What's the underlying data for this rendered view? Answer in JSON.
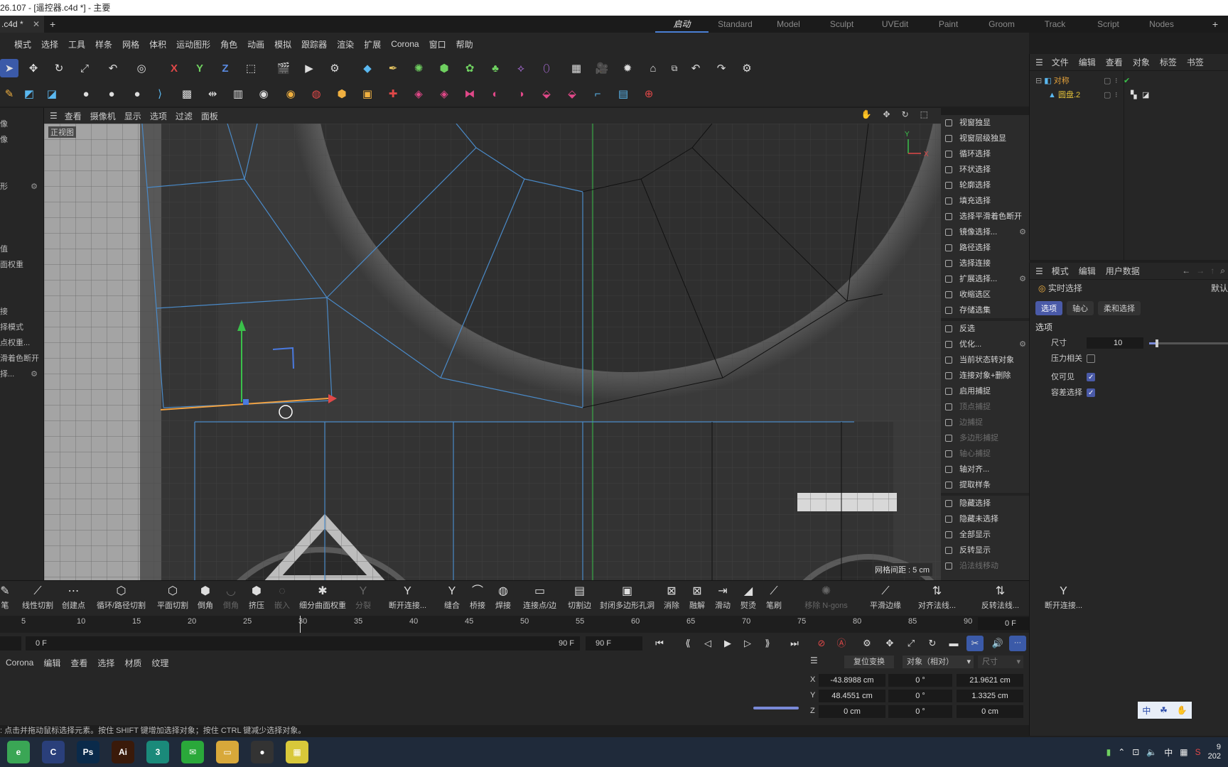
{
  "title": "26.107 - [遥控器.c4d *] - 主要",
  "file_tab": ".c4d *",
  "layouts": [
    "启动",
    "Standard",
    "Model",
    "Sculpt",
    "UVEdit",
    "Paint",
    "Groom",
    "Track",
    "Script",
    "Nodes"
  ],
  "menu": [
    "模式",
    "选择",
    "工具",
    "样条",
    "网格",
    "体积",
    "运动图形",
    "角色",
    "动画",
    "模拟",
    "跟踪器",
    "渲染",
    "扩展",
    "Corona",
    "窗口",
    "帮助"
  ],
  "left_panel": [
    "像",
    "像",
    "",
    "",
    "形",
    "",
    "",
    "",
    "值",
    "面权重",
    "",
    "",
    "接",
    "择模式",
    "点权重...",
    "滑着色断开",
    "择..."
  ],
  "viewport_menu": [
    "查看",
    "摄像机",
    "显示",
    "选项",
    "过滤",
    "面板"
  ],
  "viewport_label": "正视图",
  "grid_info": "网格间距 : 5 cm",
  "axis": {
    "y": "Y",
    "x": "X"
  },
  "right_menu": [
    {
      "label": "视窗独显",
      "dim": false
    },
    {
      "label": "视窗层级独显",
      "dim": false
    },
    {
      "label": "循环选择",
      "dim": false
    },
    {
      "label": "环状选择",
      "dim": false
    },
    {
      "label": "轮廓选择",
      "dim": false
    },
    {
      "label": "填充选择",
      "dim": false
    },
    {
      "label": "选择平滑着色断开",
      "dim": false
    },
    {
      "label": "镜像选择...",
      "dim": false,
      "gear": true
    },
    {
      "label": "路径选择",
      "dim": false
    },
    {
      "label": "选择连接",
      "dim": false
    },
    {
      "label": "扩展选择...",
      "dim": false,
      "gear": true
    },
    {
      "label": "收缩选区",
      "dim": false
    },
    {
      "label": "存储选集",
      "dim": false
    },
    {
      "label": "反选",
      "dim": false,
      "sep": true
    },
    {
      "label": "优化...",
      "dim": false,
      "gear": true
    },
    {
      "label": "当前状态转对象",
      "dim": false
    },
    {
      "label": "连接对象+删除",
      "dim": false
    },
    {
      "label": "启用捕捉",
      "dim": false
    },
    {
      "label": "顶点捕捉",
      "dim": true
    },
    {
      "label": "边捕捉",
      "dim": true
    },
    {
      "label": "多边形捕捉",
      "dim": true
    },
    {
      "label": "轴心捕捉",
      "dim": true
    },
    {
      "label": "轴对齐...",
      "dim": false
    },
    {
      "label": "提取样条",
      "dim": false
    },
    {
      "label": "隐藏选择",
      "dim": false,
      "sep": true
    },
    {
      "label": "隐藏未选择",
      "dim": false
    },
    {
      "label": "全部显示",
      "dim": false
    },
    {
      "label": "反转显示",
      "dim": false
    },
    {
      "label": "沿法线移动",
      "dim": true
    }
  ],
  "object_manager": {
    "menu": [
      "文件",
      "编辑",
      "查看",
      "对象",
      "标签",
      "书签"
    ],
    "objects": [
      {
        "name": "对称",
        "color": "#e3a13a"
      },
      {
        "name": "圆盘.2",
        "color": "#e3c23a"
      }
    ]
  },
  "attributes": {
    "menu": [
      "模式",
      "编辑",
      "用户数据"
    ],
    "tool_name": "实时选择",
    "right_label": "默认",
    "tabs": [
      "选项",
      "轴心",
      "柔和选择"
    ],
    "section": "选项",
    "size_label": "尺寸",
    "size_value": "10",
    "size_fraction": 0.1,
    "pressure_label": "压力相关",
    "visible_only_label": "仅可见",
    "tolerant_label": "容差选择"
  },
  "bottom_tools": [
    {
      "label": "笔",
      "icon": "✎",
      "dim": false
    },
    {
      "label": "线性切割",
      "icon": "⟋",
      "dim": false
    },
    {
      "label": "创建点",
      "icon": "⋯",
      "dim": false
    },
    {
      "label": "循环/路径切割",
      "icon": "⬡",
      "dim": false
    },
    {
      "label": "平面切割",
      "icon": "⬡",
      "dim": false
    },
    {
      "label": "倒角",
      "icon": "⬢",
      "dim": false
    },
    {
      "label": "倒角",
      "icon": "◡",
      "dim": true
    },
    {
      "label": "挤压",
      "icon": "⬢",
      "dim": false
    },
    {
      "label": "嵌入",
      "icon": "◌",
      "dim": true
    },
    {
      "label": "细分曲面权重",
      "icon": "✱",
      "dim": false
    },
    {
      "label": "分裂",
      "icon": "Y",
      "dim": true
    },
    {
      "label": "断开连接...",
      "icon": "Y",
      "dim": false
    },
    {
      "label": "缝合",
      "icon": "Y",
      "dim": false
    },
    {
      "label": "桥接",
      "icon": "⌒",
      "dim": false
    },
    {
      "label": "焊接",
      "icon": "◍",
      "dim": false
    },
    {
      "label": "连接点/边",
      "icon": "▭",
      "dim": false
    },
    {
      "label": "切割边",
      "icon": "▤",
      "dim": false
    },
    {
      "label": "封闭多边形孔洞",
      "icon": "▣",
      "dim": false
    },
    {
      "label": "消除",
      "icon": "⊠",
      "dim": false
    },
    {
      "label": "融解",
      "icon": "⊠",
      "dim": false
    },
    {
      "label": "滑动",
      "icon": "⇥",
      "dim": false
    },
    {
      "label": "熨烫",
      "icon": "◢",
      "dim": false
    },
    {
      "label": "笔刷",
      "icon": "⟋",
      "dim": false
    },
    {
      "label": "移除 N-gons",
      "icon": "✺",
      "dim": true
    },
    {
      "label": "平滑边缘",
      "icon": "⟋",
      "dim": false
    },
    {
      "label": "对齐法线...",
      "icon": "⇅",
      "dim": false
    },
    {
      "label": "反转法线...",
      "icon": "⇅",
      "dim": false
    },
    {
      "label": "断开连接...",
      "icon": "Y",
      "dim": false
    }
  ],
  "timeline_ticks": [
    "5",
    "10",
    "15",
    "20",
    "25",
    "30",
    "35",
    "40",
    "45",
    "50",
    "55",
    "60",
    "65",
    "70",
    "75",
    "80",
    "85",
    "90"
  ],
  "current_frame": "0 F",
  "transport": {
    "start": "0 F",
    "end1": "90 F",
    "end2": "90 F"
  },
  "material_menu": [
    "Corona",
    "编辑",
    "查看",
    "选择",
    "材质",
    "纹理"
  ],
  "coordinates": {
    "reset_label": "复位变换",
    "mode": "对象（相对）",
    "size_label": "尺寸",
    "rows": [
      {
        "axis": "X",
        "pos": "-43.8988 cm",
        "rot": "0 °",
        "size": "21.9621 cm"
      },
      {
        "axis": "Y",
        "pos": "48.4551 cm",
        "rot": "0 °",
        "size": "1.3325 cm"
      },
      {
        "axis": "Z",
        "pos": "0 cm",
        "rot": "0 °",
        "size": "0 cm"
      }
    ]
  },
  "status": ": 点击并拖动鼠标选择元素。按住 SHIFT 键增加选择对象；按住 CTRL 键减少选择对象。",
  "taskbar_apps": [
    {
      "name": "browser-icon",
      "label": "e",
      "color": "#3aa655"
    },
    {
      "name": "cinema4d-icon",
      "label": "C",
      "color": "#2a3f7a"
    },
    {
      "name": "photoshop-icon",
      "label": "Ps",
      "color": "#0a2a4a"
    },
    {
      "name": "illustrator-icon",
      "label": "Ai",
      "color": "#3a1a0a"
    },
    {
      "name": "app3-icon",
      "label": "3",
      "color": "#1a8a7a"
    },
    {
      "name": "wechat-icon",
      "label": "✉",
      "color": "#2aa83a"
    },
    {
      "name": "folder-icon",
      "label": "▭",
      "color": "#d8a83a"
    },
    {
      "name": "record-icon",
      "label": "●",
      "color": "#333333"
    },
    {
      "name": "notepad-icon",
      "label": "▦",
      "color": "#d8c83a"
    }
  ],
  "tray": {
    "ime": "中",
    "ime2": "中",
    "clock_top": "9",
    "clock_bottom": "202"
  }
}
